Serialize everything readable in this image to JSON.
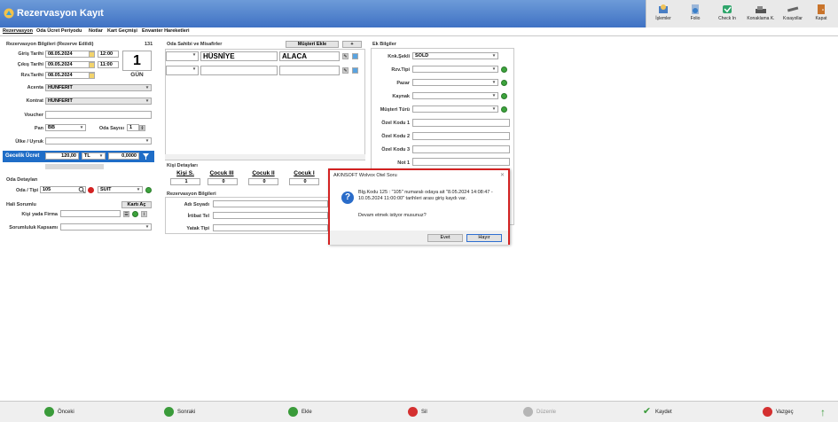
{
  "window": {
    "title": "Rezervasyon Kayıt"
  },
  "toolbar": [
    {
      "label": "İşlemler",
      "icon": "operations-icon"
    },
    {
      "label": "Folio",
      "icon": "folio-icon"
    },
    {
      "label": "Check In",
      "icon": "checkin-icon"
    },
    {
      "label": "Konaklama K.",
      "icon": "accommodation-icon"
    },
    {
      "label": "Kısayollar",
      "icon": "shortcuts-icon"
    },
    {
      "label": "Kapat",
      "icon": "close-door-icon"
    }
  ],
  "tabs": [
    "Rezervasyon",
    "Oda Ücret Periyodu",
    "Notlar",
    "Kart Geçmişi",
    "Envanter Hareketleri"
  ],
  "reservation": {
    "section_title": "Rezervasyon Bilgileri (Rezerve Edildi)",
    "number": "131",
    "checkin_label": "Giriş Tarihi",
    "checkin_date": "08.05.2024",
    "checkin_time": "12:00",
    "checkout_label": "Çıkış Tarihi",
    "checkout_date": "09.05.2024",
    "checkout_time": "11:00",
    "rzv_label": "Rzv.Tarihi",
    "rzv_date": "08.05.2024",
    "nights": "1",
    "nights_unit": "GÜN",
    "agency_label": "Acenta",
    "agency": "HÜNFERİT",
    "contract_label": "Kontrat",
    "contract": "HÜNFERİT",
    "voucher_label": "Voucher",
    "voucher": "",
    "board_label": "Pan",
    "board": "BB",
    "rooms_label": "Oda Sayısı",
    "rooms": "1",
    "country_label": "Ülke / Uyruk",
    "country": "",
    "nightly_label": "Gecelik Ücret",
    "nightly_amount": "120,00",
    "currency": "TL",
    "discount": "0,0000"
  },
  "room": {
    "section_title": "Oda Detayları",
    "label": "Oda / Tipi",
    "number": "105",
    "type": "SUIT"
  },
  "accountant": {
    "section_title": "Hali Sorumlu",
    "card_button": "Kartı Aç",
    "person_label": "Kişi yada Firma",
    "person": "",
    "scope_label": "Sorumluluk Kapsamı",
    "scope": ""
  },
  "guests": {
    "section_title": "Oda Sahibi ve Misafirler",
    "add_button": "Müşteri Ekle",
    "plus_button": "+",
    "first_name": "HÜSNİYE",
    "last_name": "ALACA"
  },
  "people": {
    "section_title": "Kişi Detayları",
    "cols": [
      {
        "label": "Kişi S.",
        "value": "1"
      },
      {
        "label": "Çocuk III",
        "value": "0"
      },
      {
        "label": "Çocuk II",
        "value": "0"
      },
      {
        "label": "Çocuk I",
        "value": "0"
      }
    ]
  },
  "res_info": {
    "section_title": "Rezervasyon Bilgileri",
    "name_label": "Adı Soyadı",
    "phone_label": "İrtibat Tel",
    "bed_label": "Yatak Tipi"
  },
  "extra": {
    "section_title": "Ek Bilgiler",
    "fields": [
      {
        "label": "Knk.Şekli",
        "value": "SOLD",
        "kind": "select"
      },
      {
        "label": "Rzv.Tipi",
        "value": "",
        "kind": "select"
      },
      {
        "label": "Pazar",
        "value": "",
        "kind": "select"
      },
      {
        "label": "Kaynak",
        "value": "",
        "kind": "select"
      },
      {
        "label": "Müşteri Türü",
        "value": "",
        "kind": "select"
      },
      {
        "label": "Özel Kodu 1",
        "value": "",
        "kind": "input"
      },
      {
        "label": "Özel Kodu 2",
        "value": "",
        "kind": "input"
      },
      {
        "label": "Özel Kodu 3",
        "value": "",
        "kind": "input"
      },
      {
        "label": "Not 1",
        "value": "",
        "kind": "input"
      }
    ]
  },
  "dialog": {
    "title": "AKINSOFT Wolvox Otel Soru",
    "message": "Blg.Kodu 125 : \"105\" numaralı odaya ait \"8.05.2024 14:08:47 - 10.05.2024 11:00:00\" tarihleri arası giriş kaydı var.",
    "question": "Devam etmek istiyor musunuz?",
    "yes": "Evet",
    "no": "Hayır"
  },
  "bottom": [
    {
      "label": "Önceki",
      "color": "#3a9b3a"
    },
    {
      "label": "Sonraki",
      "color": "#3a9b3a"
    },
    {
      "label": "Ekle",
      "color": "#3a9b3a"
    },
    {
      "label": "Sil",
      "color": "#d43030"
    },
    {
      "label": "Düzenle",
      "color": "#b5b5b5"
    },
    {
      "label": "Kaydet",
      "color": "#3a9b3a"
    },
    {
      "label": "Vazgeç",
      "color": "#d43030"
    }
  ]
}
